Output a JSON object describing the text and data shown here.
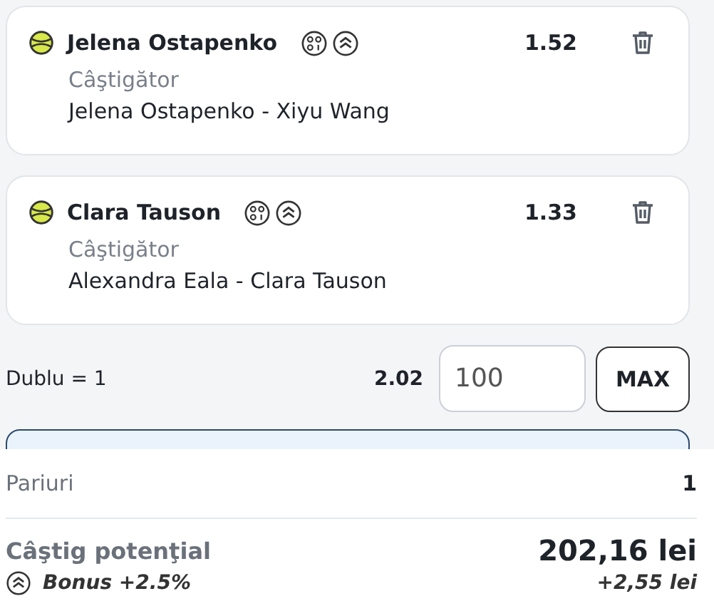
{
  "selections": [
    {
      "player": "Jelena Ostapenko",
      "odds": "1.52",
      "market": "Câştigător",
      "match": "Jelena Ostapenko - Xiyu Wang"
    },
    {
      "player": "Clara Tauson",
      "odds": "1.33",
      "market": "Câştigător",
      "match": "Alexandra Eala - Clara Tauson"
    }
  ],
  "combo": {
    "label": "Dublu = 1",
    "odds": "2.02",
    "stake": "100",
    "max_button": "MAX"
  },
  "summary": {
    "bets_label": "Pariuri",
    "bets_count": "1",
    "win_label": "Câştig potenţial",
    "win_value": "202,16 lei",
    "bonus_label": "Bonus +2.5%",
    "bonus_value": "+2,55 lei"
  }
}
